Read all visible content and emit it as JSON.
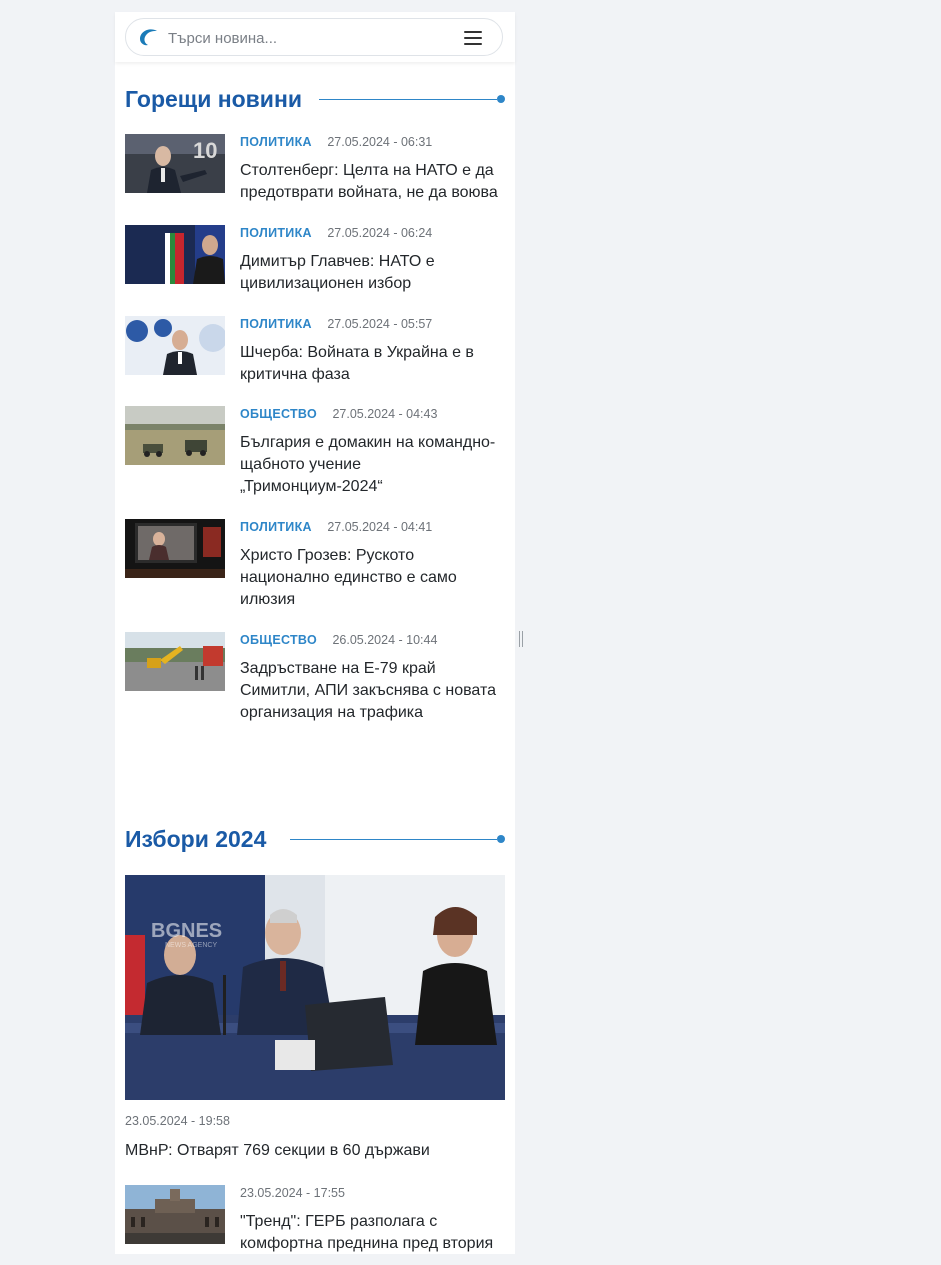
{
  "search": {
    "placeholder": "Търси новина..."
  },
  "hot_news": {
    "title": "Горещи новини",
    "items": [
      {
        "category": "ПОЛИТИКА",
        "date": "27.05.2024 - 06:31",
        "title": "Столтенберг: Целта на НАТО е да предотврати войната, не да воюва"
      },
      {
        "category": "ПОЛИТИКА",
        "date": "27.05.2024 - 06:24",
        "title": "Димитър Главчев: НАТО е цивилизационен избор"
      },
      {
        "category": "ПОЛИТИКА",
        "date": "27.05.2024 - 05:57",
        "title": "Шчерба: Войната в Украйна е в критична фаза"
      },
      {
        "category": "ОБЩЕСТВО",
        "date": "27.05.2024 - 04:43",
        "title": "България е домакин на командно-щабното учение „Тримонциум-2024“"
      },
      {
        "category": "ПОЛИТИКА",
        "date": "27.05.2024 - 04:41",
        "title": "Христо Грозев: Руското национално единство е само илюзия"
      },
      {
        "category": "ОБЩЕСТВО",
        "date": "26.05.2024 - 10:44",
        "title": "Задръстване на Е-79 край Симитли, АПИ закъснява с новата организация на трафика"
      }
    ]
  },
  "elections": {
    "title": "Избори 2024",
    "featured": {
      "date": "23.05.2024 - 19:58",
      "title": "МВнР: Отварят 769 секции в 60 държави",
      "watermark": "BGNES",
      "watermark_sub": "NEWS AGENCY"
    },
    "items": [
      {
        "date": "23.05.2024 - 17:55",
        "title": "\"Тренд\": ГЕРБ разполага с комфортна преднина пред втория"
      }
    ]
  },
  "colors": {
    "accent": "#2e86c8",
    "heading": "#1a5aa6",
    "text": "#23272b",
    "muted": "#6d7278"
  },
  "icons": {
    "logo": "bta-logo-icon",
    "menu": "hamburger-menu-icon"
  }
}
